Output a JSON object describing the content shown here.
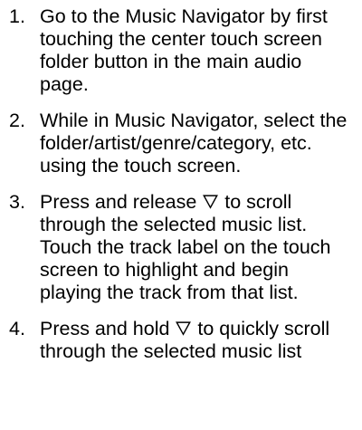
{
  "steps": [
    {
      "number": "1.",
      "text": "Go to the Music Navigator by first touching the center touch screen folder button in the main audio page."
    },
    {
      "number": "2.",
      "text": "While in Music Navigator, select the folder/artist/genre/category, etc. using the touch screen."
    },
    {
      "number": "3.",
      "text_before": "Press and release ",
      "icon": "down-triangle-icon",
      "text_after": " to scroll through the selected music list. Touch the track label on the touch screen to highlight and begin playing the track from that list."
    },
    {
      "number": "4.",
      "text_before": "Press and hold ",
      "icon": "down-triangle-icon",
      "text_after": " to quickly scroll through the selected music list"
    }
  ]
}
